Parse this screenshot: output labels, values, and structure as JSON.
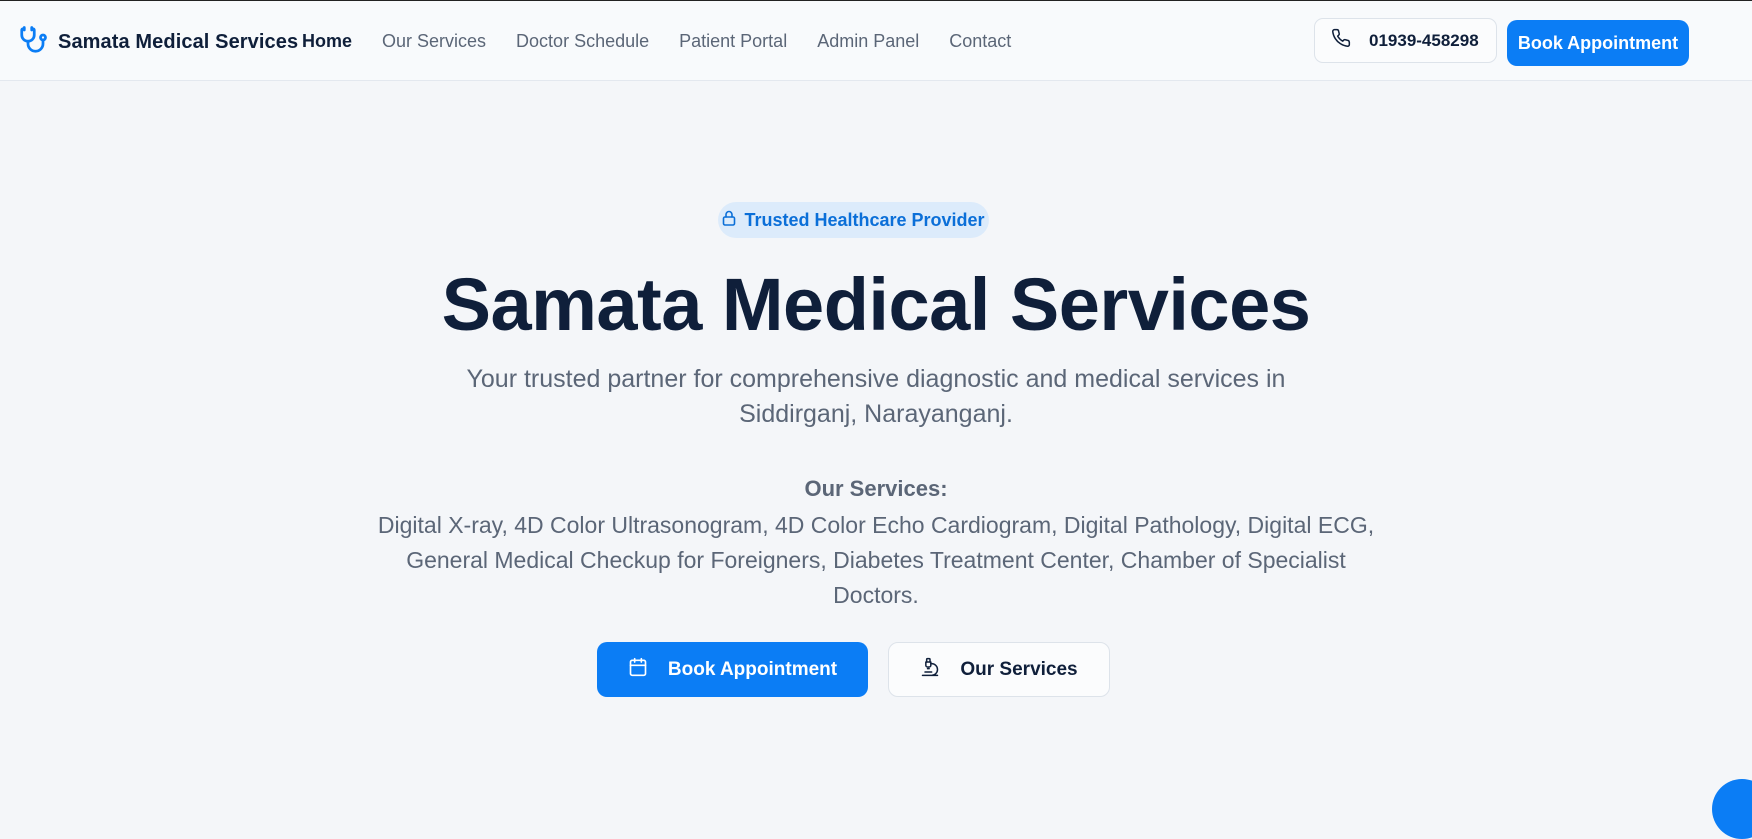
{
  "header": {
    "brand": "Samata Medical Services",
    "nav": [
      "Home",
      "Our Services",
      "Doctor Schedule",
      "Patient Portal",
      "Admin Panel",
      "Contact"
    ],
    "phone": "01939-458298",
    "cta": "Book Appointment"
  },
  "hero": {
    "badge": "Trusted Healthcare Provider",
    "title": "Samata Medical Services",
    "subtitle": "Your trusted partner for comprehensive diagnostic and medical services in Siddirganj, Narayanganj.",
    "services_heading": "Our Services:",
    "services_list": "Digital X-ray, 4D Color Ultrasonogram, 4D Color Echo Cardiogram, Digital Pathology, Digital ECG, General Medical Checkup for Foreigners, Diabetes Treatment Center, Chamber of Specialist Doctors.",
    "primary_button": "Book Appointment",
    "secondary_button": "Our Services"
  },
  "colors": {
    "accent": "#0b7df5",
    "text_dark": "#0f1f3a",
    "text_muted": "#5b6677",
    "badge_bg": "#dcebfb"
  },
  "icons": {
    "brand": "stethoscope-icon",
    "phone": "phone-icon",
    "badge": "lock-icon",
    "primary_button": "calendar-icon",
    "secondary_button": "microscope-icon",
    "fab": "chat-icon"
  }
}
